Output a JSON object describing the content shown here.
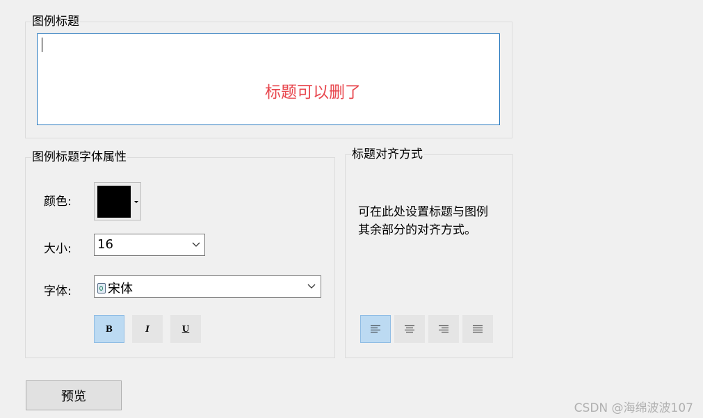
{
  "legend_title_group": {
    "label": "图例标题",
    "text_value": "",
    "annotation": "标题可以删了"
  },
  "font_group": {
    "label": "图例标题字体属性",
    "color_label": "颜色:",
    "color_value": "#000000",
    "size_label": "大小:",
    "size_value": "16",
    "font_label": "字体:",
    "font_value": "宋体",
    "bold_label": "B",
    "italic_label": "I",
    "underline_label": "U"
  },
  "align_group": {
    "label": "标题对齐方式",
    "description": "可在此处设置标题与图例其余部分的对齐方式。",
    "selected": "left"
  },
  "preview_button": "预览",
  "watermark": "CSDN @海绵波波107",
  "colors": {
    "focus_border": "#2c7cc0",
    "annotation": "#e8484f",
    "selected_button": "#bcdaf2"
  }
}
